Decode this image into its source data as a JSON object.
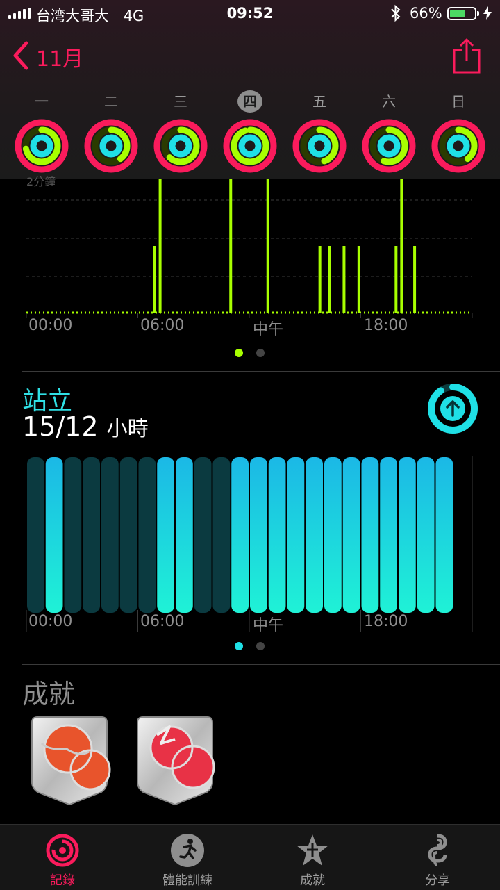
{
  "status_bar": {
    "carrier": "台湾大哥大",
    "network": "4G",
    "time": "09:52",
    "battery_pct": "66%",
    "battery_level": 0.66
  },
  "nav": {
    "back_label": "11月",
    "back_icon": "chevron-left-icon",
    "share_icon": "share-icon"
  },
  "week": {
    "days": [
      "一",
      "二",
      "三",
      "四",
      "五",
      "六",
      "日"
    ],
    "selected_index": 3,
    "rings": [
      {
        "move": 1.0,
        "exercise": 0.72,
        "stand": 0.95
      },
      {
        "move": 1.0,
        "exercise": 0.4,
        "stand": 0.95
      },
      {
        "move": 1.0,
        "exercise": 0.62,
        "stand": 0.95
      },
      {
        "move": 1.0,
        "exercise": 0.95,
        "stand": 1.0
      },
      {
        "move": 1.0,
        "exercise": 0.45,
        "stand": 0.95
      },
      {
        "move": 1.0,
        "exercise": 0.55,
        "stand": 0.95
      },
      {
        "move": 1.0,
        "exercise": 0.4,
        "stand": 0.95
      }
    ]
  },
  "exercise_chart": {
    "top_label": "2分鐘",
    "x_labels": [
      "00:00",
      "06:00",
      "中午",
      "18:00"
    ],
    "page_dots": 2,
    "active_dot": 0
  },
  "stand": {
    "title": "站立",
    "value": "15/12",
    "unit": "小時",
    "icon": "stand-arrow-up-icon",
    "x_labels": [
      "00:00",
      "06:00",
      "中午",
      "18:00"
    ],
    "page_dots": 2,
    "active_dot": 0
  },
  "achievements": {
    "title": "成就",
    "badges": [
      "achievement-badge-icon",
      "achievement-badge-icon"
    ]
  },
  "tabbar": {
    "items": [
      {
        "label": "記錄",
        "icon": "activity-rings-icon",
        "active": true
      },
      {
        "label": "體能訓練",
        "icon": "workout-runner-icon",
        "active": false
      },
      {
        "label": "成就",
        "icon": "achievement-star-icon",
        "active": false
      },
      {
        "label": "分享",
        "icon": "sharing-icon",
        "active": false
      }
    ]
  },
  "colors": {
    "move": "#fa1b5c",
    "exercise": "#a8ff00",
    "stand": "#1fe0e6",
    "accent": "#fa1b5c"
  },
  "chart_data": [
    {
      "type": "bar",
      "x_unit": "hour of day",
      "x_ticks": [
        "00:00",
        "06:00",
        "中午",
        "18:00"
      ],
      "y_unit": "minutes",
      "ylim": [
        0,
        3
      ],
      "bars": [
        {
          "hour": 6.9,
          "value": 1.5
        },
        {
          "hour": 7.2,
          "value": 3
        },
        {
          "hour": 11.0,
          "value": 3
        },
        {
          "hour": 13.0,
          "value": 3
        },
        {
          "hour": 15.8,
          "value": 1.5
        },
        {
          "hour": 16.3,
          "value": 1.5
        },
        {
          "hour": 17.1,
          "value": 1.5
        },
        {
          "hour": 17.9,
          "value": 1.5
        },
        {
          "hour": 19.9,
          "value": 1.5
        },
        {
          "hour": 20.2,
          "value": 3
        },
        {
          "hour": 20.9,
          "value": 1.5
        }
      ]
    },
    {
      "type": "bar",
      "x_unit": "hour of day",
      "x_ticks": [
        "00:00",
        "06:00",
        "中午",
        "18:00"
      ],
      "hours": [
        0,
        1,
        2,
        3,
        4,
        5,
        6,
        7,
        8,
        9,
        10,
        11,
        12,
        13,
        14,
        15,
        16,
        17,
        18,
        19,
        20,
        21,
        22
      ],
      "stood": [
        0,
        1,
        0,
        0,
        0,
        0,
        0,
        1,
        1,
        0,
        0,
        1,
        1,
        1,
        1,
        1,
        1,
        1,
        1,
        1,
        1,
        1,
        1
      ]
    }
  ]
}
